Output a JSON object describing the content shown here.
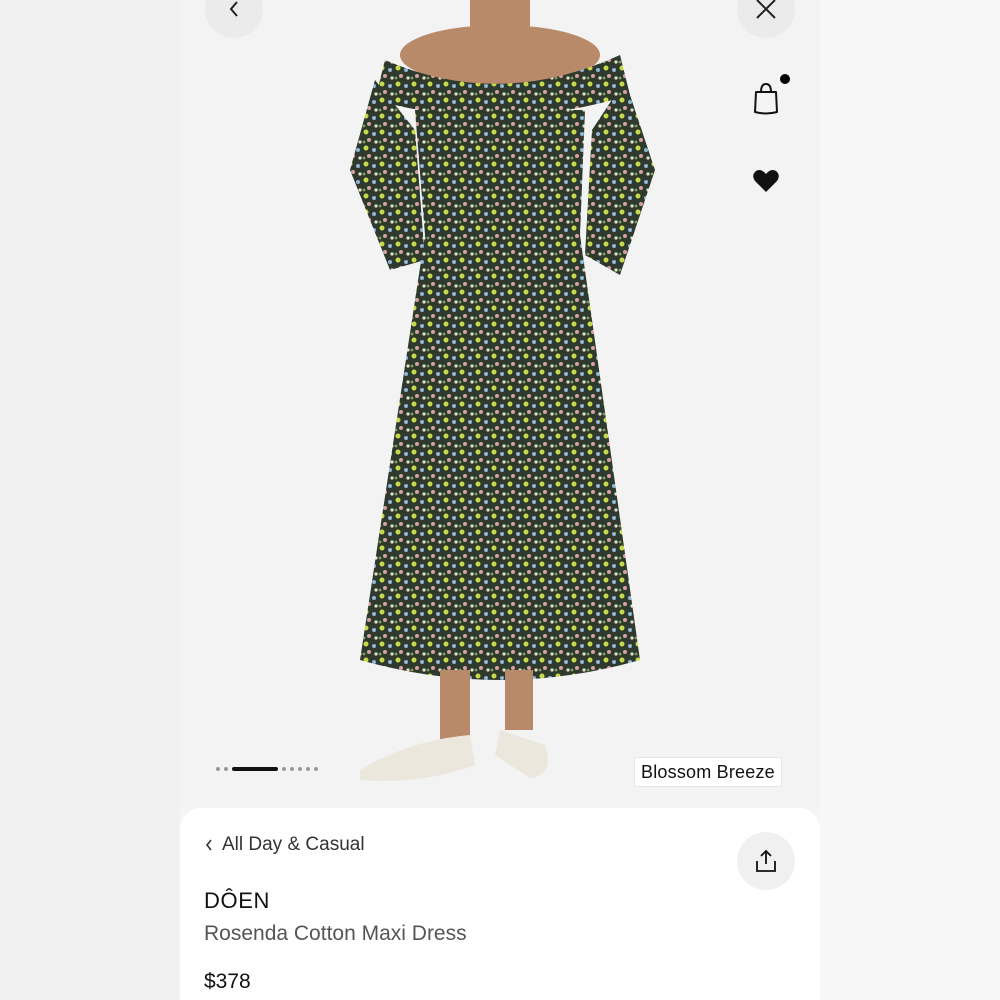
{
  "header": {
    "back_icon": "chevron-left-icon",
    "close_icon": "close-icon",
    "bag_icon": "shopping-bag-icon",
    "bag_has_items": true,
    "wishlist_icon": "heart-icon",
    "wishlist_active": true
  },
  "gallery": {
    "total_images": 8,
    "active_index": 2,
    "color_name": "Blossom Breeze"
  },
  "product": {
    "breadcrumb": "All Day & Casual",
    "brand": "DÔEN",
    "name": "Rosenda Cotton Maxi Dress",
    "price": "$378",
    "share_icon": "share-icon"
  },
  "colors": {
    "accent": "#111111",
    "background": "#f5f5f5",
    "card": "#ffffff"
  }
}
